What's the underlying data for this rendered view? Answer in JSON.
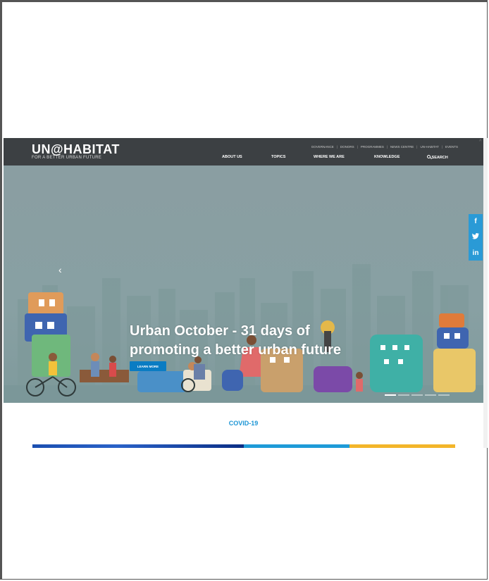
{
  "header": {
    "logo": "UN@HABITAT",
    "tagline": "FOR A BETTER URBAN FUTURE",
    "top_links": [
      "GOVERNANCE",
      "DONORS",
      "PROGRAMMES",
      "NEWS CENTRE",
      "UN-HABITAT",
      "EVENTS"
    ],
    "nav": {
      "about": "ABOUT US",
      "topics": "TOPICS",
      "where": "WHERE WE ARE",
      "knowledge": "KNOWLEDGE",
      "search": "SEARCH"
    }
  },
  "hero": {
    "title_line1": "Urban October - 31 days of",
    "title_line2": "promoting a better urban future",
    "button": "LEARN MORE",
    "prev_arrow": "‹",
    "slides": 5,
    "active_slide": 1
  },
  "social": {
    "facebook": "f",
    "twitter": "t",
    "linkedin": "in"
  },
  "section": {
    "label": "COVID-19"
  },
  "colors": {
    "header_bg": "#3c4043",
    "accent_blue": "#1b95d5",
    "button_blue": "#0a7cc3",
    "yellow": "#f3b52a"
  }
}
